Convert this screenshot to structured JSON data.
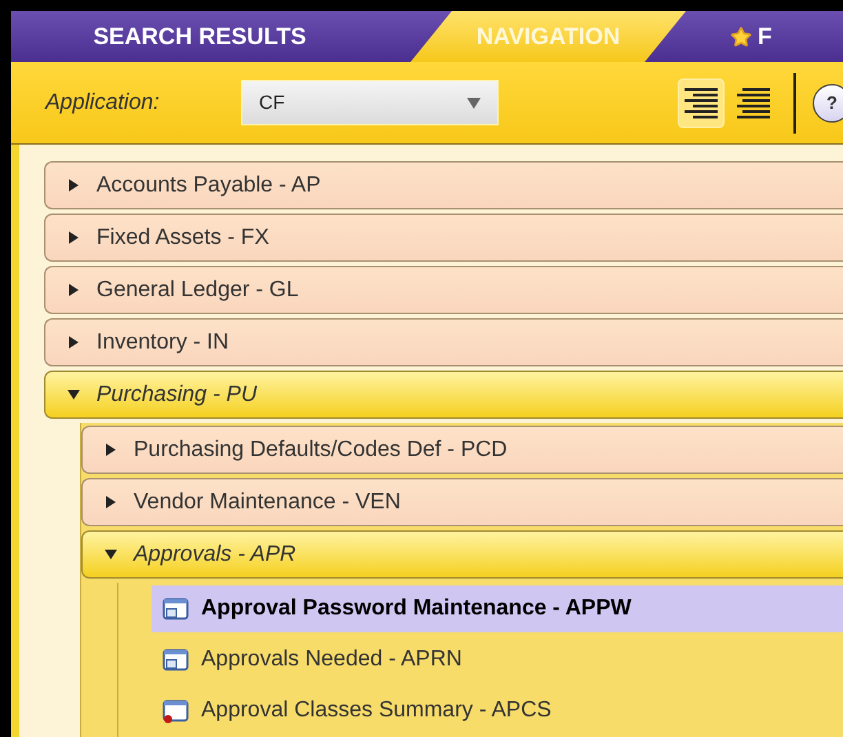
{
  "tabs": [
    {
      "label": "SEARCH RESULTS",
      "selected": false,
      "kind": "text"
    },
    {
      "label": "NAVIGATION",
      "selected": true,
      "kind": "text"
    },
    {
      "label": "F",
      "selected": false,
      "kind": "star"
    }
  ],
  "toolbar": {
    "label": "Application:",
    "select_value": "CF",
    "view_buttons": [
      {
        "selected": true
      },
      {
        "selected": false
      }
    ],
    "help": "?"
  },
  "tree": [
    {
      "label": "Accounts Payable - AP",
      "expanded": false
    },
    {
      "label": "Fixed Assets - FX",
      "expanded": false
    },
    {
      "label": "General Ledger - GL",
      "expanded": false
    },
    {
      "label": "Inventory - IN",
      "expanded": false
    },
    {
      "label": "Purchasing - PU",
      "expanded": true,
      "children": [
        {
          "label": "Purchasing Defaults/Codes Def - PCD",
          "expanded": false
        },
        {
          "label": "Vendor Maintenance - VEN",
          "expanded": false
        },
        {
          "label": "Approvals - APR",
          "expanded": true,
          "children": [
            {
              "label": "Approval Password Maintenance - APPW",
              "kind": "screen",
              "selected": true
            },
            {
              "label": "Approvals Needed - APRN",
              "kind": "screen",
              "selected": false
            },
            {
              "label": "Approval Classes Summary - APCS",
              "kind": "alert",
              "selected": false
            }
          ]
        }
      ]
    }
  ]
}
